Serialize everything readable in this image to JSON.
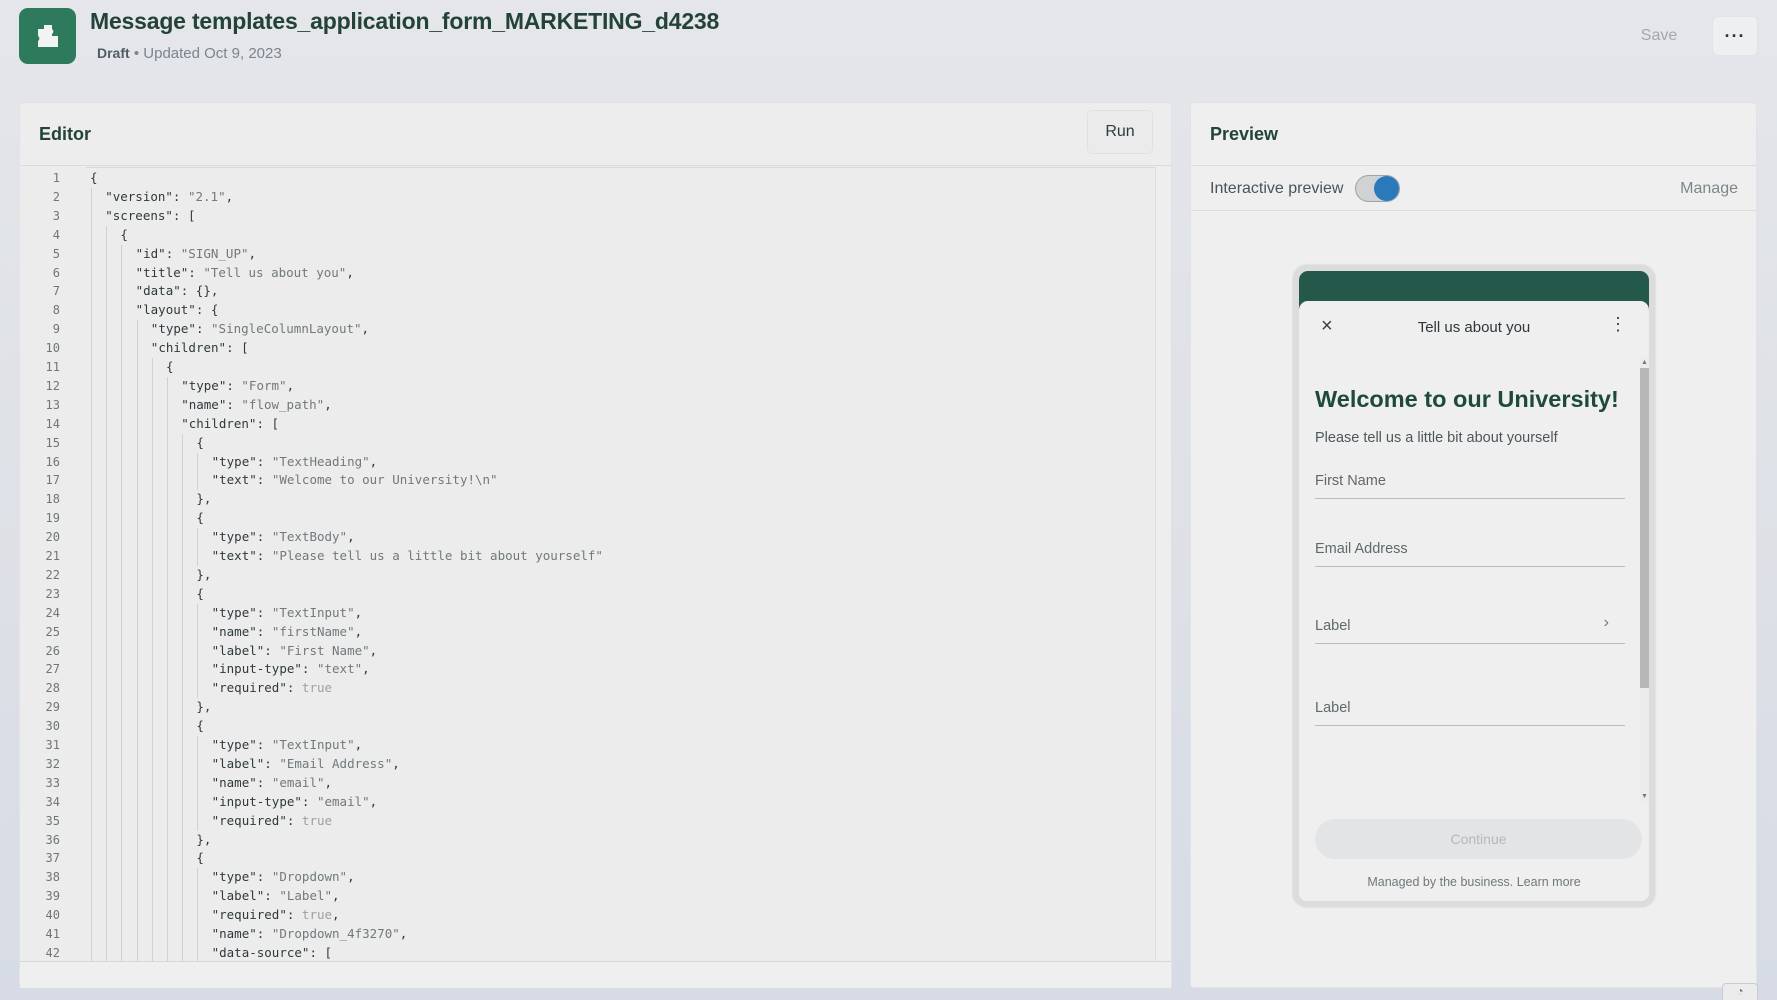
{
  "header": {
    "title": "Message templates_application_form_MARKETING_d4238",
    "status": "Draft",
    "updated": "• Updated Oct 9, 2023",
    "save_label": "Save",
    "more_label": "···",
    "logo_icon": "puzzle-piece-icon"
  },
  "editor": {
    "title": "Editor",
    "run_label": "Run",
    "lines": [
      {
        "n": "1",
        "indent": 0,
        "parts": [
          [
            "p",
            "{"
          ]
        ]
      },
      {
        "n": "2",
        "indent": 1,
        "parts": [
          [
            "k",
            "\"version\""
          ],
          [
            "p",
            ": "
          ],
          [
            "s",
            "\"2.1\""
          ],
          [
            "p",
            ","
          ]
        ]
      },
      {
        "n": "3",
        "indent": 1,
        "parts": [
          [
            "k",
            "\"screens\""
          ],
          [
            "p",
            ": ["
          ]
        ]
      },
      {
        "n": "4",
        "indent": 2,
        "parts": [
          [
            "p",
            "{"
          ]
        ]
      },
      {
        "n": "5",
        "indent": 3,
        "parts": [
          [
            "k",
            "\"id\""
          ],
          [
            "p",
            ": "
          ],
          [
            "s",
            "\"SIGN_UP\""
          ],
          [
            "p",
            ","
          ]
        ]
      },
      {
        "n": "6",
        "indent": 3,
        "parts": [
          [
            "k",
            "\"title\""
          ],
          [
            "p",
            ": "
          ],
          [
            "s",
            "\"Tell us about you\""
          ],
          [
            "p",
            ","
          ]
        ]
      },
      {
        "n": "7",
        "indent": 3,
        "parts": [
          [
            "k",
            "\"data\""
          ],
          [
            "p",
            ": {},"
          ]
        ]
      },
      {
        "n": "8",
        "indent": 3,
        "parts": [
          [
            "k",
            "\"layout\""
          ],
          [
            "p",
            ": {"
          ]
        ]
      },
      {
        "n": "9",
        "indent": 4,
        "parts": [
          [
            "k",
            "\"type\""
          ],
          [
            "p",
            ": "
          ],
          [
            "s",
            "\"SingleColumnLayout\""
          ],
          [
            "p",
            ","
          ]
        ]
      },
      {
        "n": "10",
        "indent": 4,
        "parts": [
          [
            "k",
            "\"children\""
          ],
          [
            "p",
            ": ["
          ]
        ]
      },
      {
        "n": "11",
        "indent": 5,
        "parts": [
          [
            "p",
            "{"
          ]
        ]
      },
      {
        "n": "12",
        "indent": 6,
        "parts": [
          [
            "k",
            "\"type\""
          ],
          [
            "p",
            ": "
          ],
          [
            "s",
            "\"Form\""
          ],
          [
            "p",
            ","
          ]
        ]
      },
      {
        "n": "13",
        "indent": 6,
        "parts": [
          [
            "k",
            "\"name\""
          ],
          [
            "p",
            ": "
          ],
          [
            "s",
            "\"flow_path\""
          ],
          [
            "p",
            ","
          ]
        ]
      },
      {
        "n": "14",
        "indent": 6,
        "parts": [
          [
            "k",
            "\"children\""
          ],
          [
            "p",
            ": ["
          ]
        ]
      },
      {
        "n": "15",
        "indent": 7,
        "parts": [
          [
            "p",
            "{"
          ]
        ]
      },
      {
        "n": "16",
        "indent": 8,
        "parts": [
          [
            "k",
            "\"type\""
          ],
          [
            "p",
            ": "
          ],
          [
            "s",
            "\"TextHeading\""
          ],
          [
            "p",
            ","
          ]
        ]
      },
      {
        "n": "17",
        "indent": 8,
        "parts": [
          [
            "k",
            "\"text\""
          ],
          [
            "p",
            ": "
          ],
          [
            "s",
            "\"Welcome to our University!\\n\""
          ]
        ]
      },
      {
        "n": "18",
        "indent": 7,
        "parts": [
          [
            "p",
            "},"
          ]
        ]
      },
      {
        "n": "19",
        "indent": 7,
        "parts": [
          [
            "p",
            "{"
          ]
        ]
      },
      {
        "n": "20",
        "indent": 8,
        "parts": [
          [
            "k",
            "\"type\""
          ],
          [
            "p",
            ": "
          ],
          [
            "s",
            "\"TextBody\""
          ],
          [
            "p",
            ","
          ]
        ]
      },
      {
        "n": "21",
        "indent": 8,
        "parts": [
          [
            "k",
            "\"text\""
          ],
          [
            "p",
            ": "
          ],
          [
            "s",
            "\"Please tell us a little bit about yourself\""
          ]
        ]
      },
      {
        "n": "22",
        "indent": 7,
        "parts": [
          [
            "p",
            "},"
          ]
        ]
      },
      {
        "n": "23",
        "indent": 7,
        "parts": [
          [
            "p",
            "{"
          ]
        ]
      },
      {
        "n": "24",
        "indent": 8,
        "parts": [
          [
            "k",
            "\"type\""
          ],
          [
            "p",
            ": "
          ],
          [
            "s",
            "\"TextInput\""
          ],
          [
            "p",
            ","
          ]
        ]
      },
      {
        "n": "25",
        "indent": 8,
        "parts": [
          [
            "k",
            "\"name\""
          ],
          [
            "p",
            ": "
          ],
          [
            "s",
            "\"firstName\""
          ],
          [
            "p",
            ","
          ]
        ]
      },
      {
        "n": "26",
        "indent": 8,
        "parts": [
          [
            "k",
            "\"label\""
          ],
          [
            "p",
            ": "
          ],
          [
            "s",
            "\"First Name\""
          ],
          [
            "p",
            ","
          ]
        ]
      },
      {
        "n": "27",
        "indent": 8,
        "parts": [
          [
            "k",
            "\"input-type\""
          ],
          [
            "p",
            ": "
          ],
          [
            "s",
            "\"text\""
          ],
          [
            "p",
            ","
          ]
        ]
      },
      {
        "n": "28",
        "indent": 8,
        "parts": [
          [
            "k",
            "\"required\""
          ],
          [
            "p",
            ": "
          ],
          [
            "b",
            "true"
          ]
        ]
      },
      {
        "n": "29",
        "indent": 7,
        "parts": [
          [
            "p",
            "},"
          ]
        ]
      },
      {
        "n": "30",
        "indent": 7,
        "parts": [
          [
            "p",
            "{"
          ]
        ]
      },
      {
        "n": "31",
        "indent": 8,
        "parts": [
          [
            "k",
            "\"type\""
          ],
          [
            "p",
            ": "
          ],
          [
            "s",
            "\"TextInput\""
          ],
          [
            "p",
            ","
          ]
        ]
      },
      {
        "n": "32",
        "indent": 8,
        "parts": [
          [
            "k",
            "\"label\""
          ],
          [
            "p",
            ": "
          ],
          [
            "s",
            "\"Email Address\""
          ],
          [
            "p",
            ","
          ]
        ]
      },
      {
        "n": "33",
        "indent": 8,
        "parts": [
          [
            "k",
            "\"name\""
          ],
          [
            "p",
            ": "
          ],
          [
            "s",
            "\"email\""
          ],
          [
            "p",
            ","
          ]
        ]
      },
      {
        "n": "34",
        "indent": 8,
        "parts": [
          [
            "k",
            "\"input-type\""
          ],
          [
            "p",
            ": "
          ],
          [
            "s",
            "\"email\""
          ],
          [
            "p",
            ","
          ]
        ]
      },
      {
        "n": "35",
        "indent": 8,
        "parts": [
          [
            "k",
            "\"required\""
          ],
          [
            "p",
            ": "
          ],
          [
            "b",
            "true"
          ]
        ]
      },
      {
        "n": "36",
        "indent": 7,
        "parts": [
          [
            "p",
            "},"
          ]
        ]
      },
      {
        "n": "37",
        "indent": 7,
        "parts": [
          [
            "p",
            "{"
          ]
        ]
      },
      {
        "n": "38",
        "indent": 8,
        "parts": [
          [
            "k",
            "\"type\""
          ],
          [
            "p",
            ": "
          ],
          [
            "s",
            "\"Dropdown\""
          ],
          [
            "p",
            ","
          ]
        ]
      },
      {
        "n": "39",
        "indent": 8,
        "parts": [
          [
            "k",
            "\"label\""
          ],
          [
            "p",
            ": "
          ],
          [
            "s",
            "\"Label\""
          ],
          [
            "p",
            ","
          ]
        ]
      },
      {
        "n": "40",
        "indent": 8,
        "parts": [
          [
            "k",
            "\"required\""
          ],
          [
            "p",
            ": "
          ],
          [
            "b",
            "true"
          ],
          [
            "p",
            ","
          ]
        ]
      },
      {
        "n": "41",
        "indent": 8,
        "parts": [
          [
            "k",
            "\"name\""
          ],
          [
            "p",
            ": "
          ],
          [
            "s",
            "\"Dropdown_4f3270\""
          ],
          [
            "p",
            ","
          ]
        ]
      },
      {
        "n": "42",
        "indent": 8,
        "parts": [
          [
            "k",
            "\"data-source\""
          ],
          [
            "p",
            ": ["
          ]
        ]
      }
    ]
  },
  "preview": {
    "title": "Preview",
    "interactive_label": "Interactive preview",
    "interactive_on": true,
    "manage_label": "Manage",
    "phone": {
      "close_icon": "×",
      "screen_title": "Tell us about you",
      "menu_icon": "⋮",
      "heading": "Welcome to our University!",
      "body": "Please tell us a little bit about yourself",
      "fields": [
        {
          "label": "First Name",
          "type": "text"
        },
        {
          "label": "Email Address",
          "type": "email"
        },
        {
          "label": "Label",
          "type": "dropdown"
        },
        {
          "label": "Label",
          "type": "text"
        }
      ],
      "continue_label": "Continue",
      "footer": "Managed by the business. Learn more"
    }
  }
}
